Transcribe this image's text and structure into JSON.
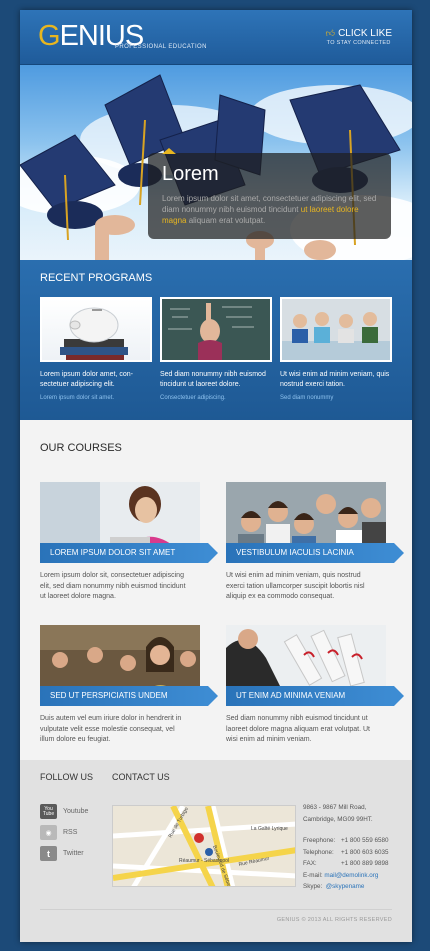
{
  "header": {
    "logo_first": "G",
    "logo_rest": "ENIUS",
    "logo_tagline": "PROFESSIONAL EDUCATION",
    "like_label": "CLICK LIKE",
    "like_sub": "TO STAY CONNECTED"
  },
  "hero": {
    "title": "Lorem",
    "text_before": "Lorem ipsum dolor sit amet, consectetuer adipiscing elit, sed diam nonummy nibh euismod tincidunt",
    "text_highlight": "ut laoreet dolore magna",
    "text_after": "aliquam erat volutpat."
  },
  "programs": {
    "title": "RECENT PROGRAMS",
    "items": [
      {
        "text": "Lorem ipsum dolor amet, con-sectetuer adipiscing elit.",
        "link": "Lorem ipsum dolor sit amet."
      },
      {
        "text": "Sed diam nonummy nibh euismod tincidunt ut laoreet dolore.",
        "link": "Consectetuer adipiscing."
      },
      {
        "text": "Ut wisi enim ad minim veniam, quis nostrud exerci tation.",
        "link": "Sed diam nonummy"
      }
    ]
  },
  "courses": {
    "title": "OUR COURSES",
    "items": [
      {
        "label": "LOREM IPSUM DOLOR SIT AMET",
        "text": "Lorem ipsum dolor sit, consectetuer adipiscing elit, sed diam nonummy nibh euismod tincidunt ut laoreet dolore magna."
      },
      {
        "label": "VESTIBULUM IACULIS LACINIA",
        "text": "Ut wisi enim ad minim veniam, quis nostrud exerci tation ullamcorper suscipit lobortis nisl aliquip ex ea commodo consequat."
      },
      {
        "label": "SED UT PERSPICIATIS UNDEM",
        "text": "Duis autem vel eum iriure dolor in hendrerit in vulputate velit esse molestie consequat, vel illum dolore eu feugiat."
      },
      {
        "label": "UT ENIM AD MINIMA VENIAM",
        "text": "Sed diam nonummy nibh euismod tincidunt ut laoreet dolore magna aliquam erat volutpat. Ut wisi enim ad minim veniam."
      }
    ]
  },
  "footer": {
    "follow_title": "FOLLOW US",
    "contact_title": "CONTACT US",
    "social": [
      {
        "label": "Youtube",
        "icon": "youtube-icon",
        "icon_text": "You Tube"
      },
      {
        "label": "RSS",
        "icon": "rss-icon",
        "icon_text": "◉"
      },
      {
        "label": "Twitter",
        "icon": "twitter-icon",
        "icon_text": "t"
      }
    ],
    "address_line1": "9863 - 9867 Mill Road,",
    "address_line2": "Cambridge, MG09 99HT.",
    "freephone_label": "Freephone:",
    "freephone": "+1 800 559 6580",
    "telephone_label": "Telephone:",
    "telephone": "+1 800 603 6035",
    "fax_label": "FAX:",
    "fax": "+1 800 889 9898",
    "email_label": "E-mail:",
    "email": "mail@demolink.org",
    "skype_label": "Skype:",
    "skype": "@skypename",
    "copyright": "GENIUS © 2013 ALL RIGHTS RESERVED",
    "map_labels": {
      "street1": "Rue de Turbigo",
      "street2": "Rue Saint-Denis",
      "street3": "Boulevard de Sébastopol",
      "street4": "Rue Réaumur",
      "place1": "Réaumur - Sébastopol",
      "place2": "La Gaîté Lyrique",
      "place3": "Rue Ste-Apolline"
    }
  }
}
